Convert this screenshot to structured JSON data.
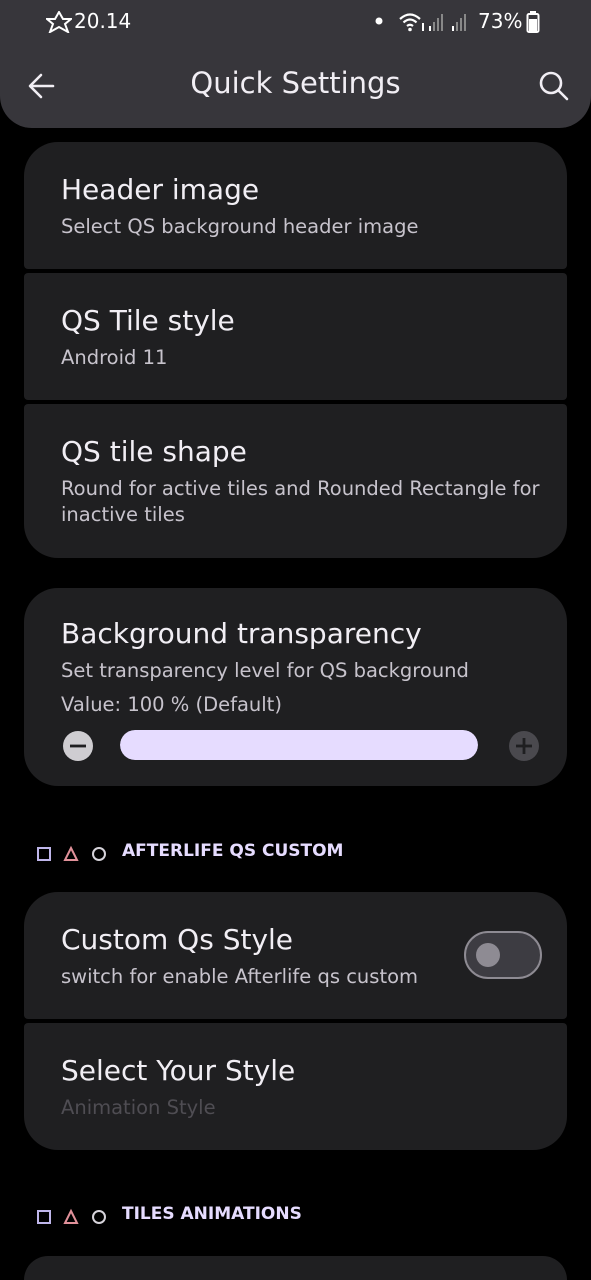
{
  "status_bar": {
    "time": "20.14",
    "battery": "73%"
  },
  "app_bar": {
    "title": "Quick Settings"
  },
  "qs_group": {
    "header_image": {
      "title": "Header image",
      "summary": "Select QS background header image"
    },
    "tile_style": {
      "title": "QS Tile style",
      "summary": "Android 11"
    },
    "tile_shape": {
      "title": "QS tile shape",
      "summary": "Round for active tiles and Rounded Rectangle for inactive tiles"
    }
  },
  "transparency": {
    "title": "Background transparency",
    "summary": "Set transparency level for QS background",
    "value_text": "Value: 100 % (Default)",
    "value": 100
  },
  "section_custom": {
    "label": "AFTERLIFE QS CUSTOM"
  },
  "custom_group": {
    "custom_style": {
      "title": "Custom Qs Style",
      "summary": "switch for enable Afterlife qs custom",
      "enabled": false
    },
    "select_style": {
      "title": "Select Your Style",
      "summary": "Animation Style"
    }
  },
  "section_tiles": {
    "label": "TILES ANIMATIONS"
  },
  "colors": {
    "accent": "#e6dcff",
    "card": "#1f1f21",
    "app_bar": "#37363b",
    "slider_fill": "#e6dcff"
  }
}
